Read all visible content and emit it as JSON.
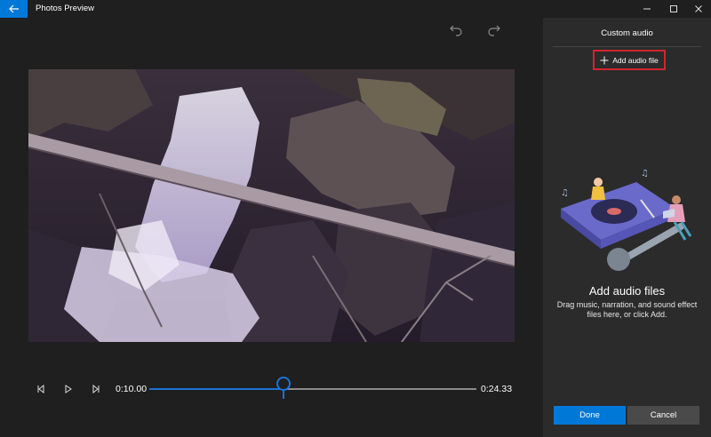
{
  "window": {
    "title": "Photos Preview",
    "accent_color": "#0078d7",
    "icons": {
      "back": "back-arrow-icon",
      "minimize": "minimize-icon",
      "maximize": "maximize-icon",
      "close": "close-icon"
    }
  },
  "toolbar": {
    "undo_icon": "undo-icon",
    "redo_icon": "redo-icon"
  },
  "player": {
    "current_time": "0:10.00",
    "total_time": "0:24.33",
    "progress": 0.41,
    "icons": {
      "previous_frame": "previous-frame-icon",
      "play": "play-icon",
      "next_frame": "next-frame-icon"
    }
  },
  "panel": {
    "title": "Custom audio",
    "add_button_label": "Add audio file",
    "heading": "Add audio files",
    "description": "Drag music, narration, and sound effect files here, or click Add.",
    "done_label": "Done",
    "cancel_label": "Cancel",
    "highlight_color": "#d0262f"
  }
}
